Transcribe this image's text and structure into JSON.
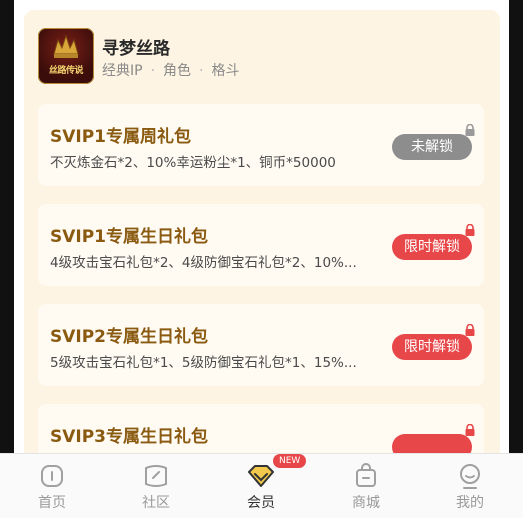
{
  "game": {
    "logo_text": "丝路传说",
    "title": "寻梦丝路",
    "tags": [
      "经典IP",
      "角色",
      "格斗"
    ]
  },
  "packs": [
    {
      "title": "SVIP1专属周礼包",
      "desc": "不灭炼金石*2、10%幸运粉尘*1、铜币*50000",
      "button": "未解锁",
      "status": "locked",
      "lock_color": "#9a9a9a"
    },
    {
      "title": "SVIP1专属生日礼包",
      "desc": "4级攻击宝石礼包*2、4级防御宝石礼包*2、10%...",
      "button": "限时解锁",
      "status": "limited",
      "lock_color": "#e8474a"
    },
    {
      "title": "SVIP2专属生日礼包",
      "desc": "5级攻击宝石礼包*1、5级防御宝石礼包*1、15%...",
      "button": "限时解锁",
      "status": "limited",
      "lock_color": "#e8474a"
    },
    {
      "title": "SVIP3专属生日礼包",
      "desc": "",
      "button": "",
      "status": "limited",
      "lock_color": "#e8474a"
    }
  ],
  "tabs": [
    {
      "label": "首页",
      "icon": "home-icon"
    },
    {
      "label": "社区",
      "icon": "community-icon"
    },
    {
      "label": "会员",
      "icon": "vip-diamond-icon",
      "badge": "NEW",
      "active": true
    },
    {
      "label": "商城",
      "icon": "shop-bag-icon"
    },
    {
      "label": "我的",
      "icon": "profile-icon"
    }
  ],
  "colors": {
    "accent_red": "#e8474a",
    "title_brown": "#8a5a10",
    "panel_bg": "#fdf4e3",
    "vip_gold": "#f2c94c"
  }
}
